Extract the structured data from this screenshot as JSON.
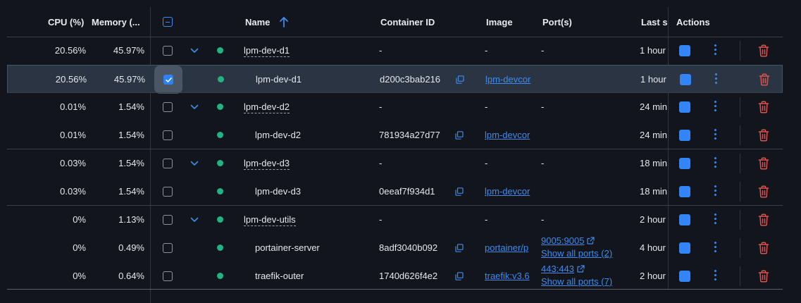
{
  "header": {
    "cpu": "CPU (%)",
    "memory": "Memory (...",
    "name": "Name",
    "container_id": "Container ID",
    "image": "Image",
    "ports": "Port(s)",
    "last": "Last s",
    "actions": "Actions"
  },
  "rows": [
    {
      "cpu": "20.56%",
      "mem": "45.97%",
      "name": "lpm-dev-d1",
      "cid": "-",
      "image": "-",
      "port": "-",
      "last": "1 hour",
      "group": true,
      "checked": false
    },
    {
      "cpu": "20.56%",
      "mem": "45.97%",
      "name": "lpm-dev-d1",
      "cid": "d200c3bab216",
      "image": "lpm-devcor",
      "port": "",
      "last": "1 hour",
      "group": false,
      "checked": true
    },
    {
      "cpu": "0.01%",
      "mem": "1.54%",
      "name": "lpm-dev-d2",
      "cid": "-",
      "image": "-",
      "port": "-",
      "last": "24 min",
      "group": true,
      "checked": false
    },
    {
      "cpu": "0.01%",
      "mem": "1.54%",
      "name": "lpm-dev-d2",
      "cid": "781934a27d77",
      "image": "lpm-devcor",
      "port": "",
      "last": "24 min",
      "group": false,
      "checked": false
    },
    {
      "cpu": "0.03%",
      "mem": "1.54%",
      "name": "lpm-dev-d3",
      "cid": "-",
      "image": "-",
      "port": "-",
      "last": "18 min",
      "group": true,
      "checked": false
    },
    {
      "cpu": "0.03%",
      "mem": "1.54%",
      "name": "lpm-dev-d3",
      "cid": "0eeaf7f934d1",
      "image": "lpm-devcor",
      "port": "",
      "last": "18 min",
      "group": false,
      "checked": false
    },
    {
      "cpu": "0%",
      "mem": "1.13%",
      "name": "lpm-dev-utils",
      "cid": "-",
      "image": "-",
      "port": "-",
      "last": "2 hour",
      "group": true,
      "checked": false
    },
    {
      "cpu": "0%",
      "mem": "0.49%",
      "name": "portainer-server",
      "cid": "8adf3040b092",
      "image": "portainer/p",
      "port": "9005:9005",
      "port_more": "Show all ports (2)",
      "last": "4 hour",
      "group": false,
      "checked": false
    },
    {
      "cpu": "0%",
      "mem": "0.64%",
      "name": "traefik-outer",
      "cid": "1740d626f4e2",
      "image": "traefik:v3.6",
      "port": "443:443",
      "port_more": "Show all ports (7)",
      "last": "2 hour",
      "group": false,
      "checked": false
    }
  ],
  "colors": {
    "accent": "#2d83f5",
    "running": "#23b383",
    "delete": "#e0524f",
    "selected_row": "#2a3442"
  }
}
